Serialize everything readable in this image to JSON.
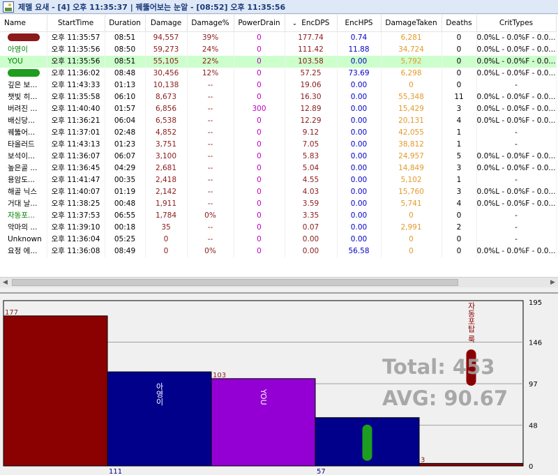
{
  "window": {
    "title": "제멜 요새 - [4] 오후 11:35:37 | 꿰뚫어보는 눈알 - [08:52] 오후 11:35:56",
    "icon": "picture-icon"
  },
  "table": {
    "columns": [
      "Name",
      "StartTime",
      "Duration",
      "Damage",
      "Damage%",
      "PowerDrain",
      "EncDPS",
      "EncHPS",
      "DamageTaken",
      "Deaths",
      "CritTypes"
    ],
    "sort_indicator": "⌄",
    "rows": [
      {
        "name": "",
        "blob": "#8b1a1a",
        "name_color": "#000000",
        "start": "오후 11:35:57",
        "duration": "08:51",
        "damage": "94,557",
        "pct": "39%",
        "drain": "0",
        "dps": "177.74",
        "hps": "0.74",
        "taken": "6,281",
        "deaths": "0",
        "crit": "0.0%L - 0.0%F - 0.0..."
      },
      {
        "name": "아영이",
        "blob": "",
        "name_color": "#008000",
        "start": "오후 11:35:56",
        "duration": "08:50",
        "damage": "59,273",
        "pct": "24%",
        "drain": "0",
        "dps": "111.42",
        "hps": "11.88",
        "taken": "34,724",
        "deaths": "0",
        "crit": "0.0%L - 0.0%F - 0.0..."
      },
      {
        "name": "YOU",
        "blob": "",
        "name_color": "#008000",
        "start": "오후 11:35:56",
        "duration": "08:51",
        "damage": "55,105",
        "pct": "22%",
        "drain": "0",
        "dps": "103.58",
        "hps": "0.00",
        "taken": "5,792",
        "deaths": "0",
        "crit": "0.0%L - 0.0%F - 0.0..."
      },
      {
        "name": "",
        "blob": "#1e9e1e",
        "name_color": "#000000",
        "start": "오후 11:36:02",
        "duration": "08:48",
        "damage": "30,456",
        "pct": "12%",
        "drain": "0",
        "dps": "57.25",
        "hps": "73.69",
        "taken": "6,298",
        "deaths": "0",
        "crit": "0.0%L - 0.0%F - 0.0..."
      },
      {
        "name": "깊은 보...",
        "blob": "",
        "name_color": "#000000",
        "start": "오후 11:43:33",
        "duration": "01:13",
        "damage": "10,138",
        "pct": "--",
        "drain": "0",
        "dps": "19.06",
        "hps": "0.00",
        "taken": "0",
        "deaths": "0",
        "crit": "-"
      },
      {
        "name": "챗빛 히...",
        "blob": "",
        "name_color": "#000000",
        "start": "오후 11:35:58",
        "duration": "06:10",
        "damage": "8,673",
        "pct": "--",
        "drain": "0",
        "dps": "16.30",
        "hps": "0.00",
        "taken": "55,348",
        "deaths": "11",
        "crit": "0.0%L - 0.0%F - 0.0..."
      },
      {
        "name": "버려진 ...",
        "blob": "",
        "name_color": "#000000",
        "start": "오후 11:40:40",
        "duration": "01:57",
        "damage": "6,856",
        "pct": "--",
        "drain": "300",
        "dps": "12.89",
        "hps": "0.00",
        "taken": "15,429",
        "deaths": "3",
        "crit": "0.0%L - 0.0%F - 0.0..."
      },
      {
        "name": "배신당...",
        "blob": "",
        "name_color": "#000000",
        "start": "오후 11:36:21",
        "duration": "06:04",
        "damage": "6,538",
        "pct": "--",
        "drain": "0",
        "dps": "12.29",
        "hps": "0.00",
        "taken": "20,131",
        "deaths": "4",
        "crit": "0.0%L - 0.0%F - 0.0..."
      },
      {
        "name": "꿰뚫어...",
        "blob": "",
        "name_color": "#000000",
        "start": "오후 11:37:01",
        "duration": "02:48",
        "damage": "4,852",
        "pct": "--",
        "drain": "0",
        "dps": "9.12",
        "hps": "0.00",
        "taken": "42,055",
        "deaths": "1",
        "crit": "-"
      },
      {
        "name": "타올러드",
        "blob": "",
        "name_color": "#000000",
        "start": "오후 11:43:13",
        "duration": "01:23",
        "damage": "3,751",
        "pct": "--",
        "drain": "0",
        "dps": "7.05",
        "hps": "0.00",
        "taken": "38,812",
        "deaths": "1",
        "crit": "-"
      },
      {
        "name": "보석이...",
        "blob": "",
        "name_color": "#000000",
        "start": "오후 11:36:07",
        "duration": "06:07",
        "damage": "3,100",
        "pct": "--",
        "drain": "0",
        "dps": "5.83",
        "hps": "0.00",
        "taken": "24,957",
        "deaths": "5",
        "crit": "0.0%L - 0.0%F - 0.0..."
      },
      {
        "name": "높은골 ...",
        "blob": "",
        "name_color": "#000000",
        "start": "오후 11:36:45",
        "duration": "04:29",
        "damage": "2,681",
        "pct": "--",
        "drain": "0",
        "dps": "5.04",
        "hps": "0.00",
        "taken": "14,849",
        "deaths": "3",
        "crit": "0.0%L - 0.0%F - 0.0..."
      },
      {
        "name": "용암도...",
        "blob": "",
        "name_color": "#000000",
        "start": "오후 11:41:47",
        "duration": "00:35",
        "damage": "2,418",
        "pct": "--",
        "drain": "0",
        "dps": "4.55",
        "hps": "0.00",
        "taken": "5,102",
        "deaths": "1",
        "crit": "-"
      },
      {
        "name": "해골 닉스",
        "blob": "",
        "name_color": "#000000",
        "start": "오후 11:40:07",
        "duration": "01:19",
        "damage": "2,142",
        "pct": "--",
        "drain": "0",
        "dps": "4.03",
        "hps": "0.00",
        "taken": "15,760",
        "deaths": "3",
        "crit": "0.0%L - 0.0%F - 0.0..."
      },
      {
        "name": "거대 날...",
        "blob": "",
        "name_color": "#000000",
        "start": "오후 11:38:25",
        "duration": "00:48",
        "damage": "1,911",
        "pct": "--",
        "drain": "0",
        "dps": "3.59",
        "hps": "0.00",
        "taken": "5,741",
        "deaths": "4",
        "crit": "0.0%L - 0.0%F - 0.0..."
      },
      {
        "name": "자동포...",
        "blob": "",
        "name_color": "#008000",
        "start": "오후 11:37:53",
        "duration": "06:55",
        "damage": "1,784",
        "pct": "0%",
        "drain": "0",
        "dps": "3.35",
        "hps": "0.00",
        "taken": "0",
        "deaths": "0",
        "crit": "-"
      },
      {
        "name": "악마의 ...",
        "blob": "",
        "name_color": "#000000",
        "start": "오후 11:39:10",
        "duration": "00:18",
        "damage": "35",
        "pct": "--",
        "drain": "0",
        "dps": "0.07",
        "hps": "0.00",
        "taken": "2,991",
        "deaths": "2",
        "crit": "-"
      },
      {
        "name": "Unknown",
        "blob": "",
        "name_color": "#000000",
        "start": "오후 11:36:04",
        "duration": "05:25",
        "damage": "0",
        "pct": "--",
        "drain": "0",
        "dps": "0.00",
        "hps": "0.00",
        "taken": "0",
        "deaths": "0",
        "crit": "-"
      },
      {
        "name": "요정 에...",
        "blob": "",
        "name_color": "#000000",
        "start": "오후 11:36:08",
        "duration": "08:49",
        "damage": "0",
        "pct": "0%",
        "drain": "0",
        "dps": "0.00",
        "hps": "56.58",
        "taken": "0",
        "deaths": "0",
        "crit": "0.0%L - 0.0%F - 0.0..."
      }
    ]
  },
  "scrollbar": {
    "left_arrow": "◀",
    "right_arrow": "▶"
  },
  "graph": {
    "total_text": "Total: 453",
    "avg_text": "AVG: 90.67",
    "label_colors": {
      "value": "#8b1a1a",
      "base": "#000080"
    },
    "background": "#f0f0f0",
    "gridline_color": "#a0a0a0"
  },
  "chart_data": {
    "type": "bar",
    "ylim": [
      0,
      195
    ],
    "yticks": [
      "195",
      "146",
      "97",
      "48",
      "0"
    ],
    "ytick_values": [
      195,
      146,
      97,
      48,
      0
    ],
    "bars": [
      {
        "label": "",
        "value": 177,
        "value_label": "177",
        "base_label": "",
        "color": "#8b0000",
        "blob": ""
      },
      {
        "label": "아영이",
        "value": 111,
        "value_label": "",
        "base_label": "111",
        "color": "#00008b",
        "blob": ""
      },
      {
        "label": "YOU",
        "value": 103,
        "value_label": "103",
        "base_label": "",
        "color": "#9400d3",
        "blob": ""
      },
      {
        "label": "",
        "value": 57,
        "value_label": "",
        "base_label": "57",
        "color": "#00008b",
        "blob": "#1e9e1e"
      },
      {
        "label": "자동포탑 룩",
        "value": 3,
        "value_label": "3",
        "base_label": "",
        "color": "#8b0000",
        "blob": "#8b0000"
      }
    ]
  }
}
